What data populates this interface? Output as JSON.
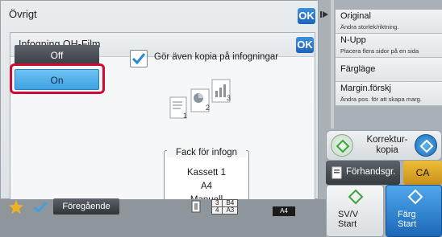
{
  "outer_window": {
    "title": "Övrigt",
    "ok_label": "OK"
  },
  "dialog": {
    "title": "Infogning OH-Film",
    "ok_label": "OK",
    "off_label": "Off",
    "on_label": "On",
    "checkbox_label": "Gör även kopia på infogningar",
    "checkbox_checked": true,
    "page_numbers": [
      "1",
      "2",
      "3"
    ],
    "fack": {
      "title": "Fack för infogn",
      "tray": "Kassett 1",
      "size": "A4",
      "type": "Manuell"
    }
  },
  "right_panel": {
    "items": [
      {
        "title": "Original",
        "subtitle": "Ändra storlek/riktning."
      },
      {
        "title": "N-Upp",
        "subtitle": "Placera flera sidor på en sida"
      },
      {
        "title": "Färgläge",
        "subtitle": ""
      },
      {
        "title": "Margin.förskj",
        "subtitle": "Ändra pos. för att skapa marg."
      }
    ],
    "korrektur_label": "Korrektur-\nkopia",
    "forhandsgr_label": "Förhandsgr.",
    "ca_label": "CA",
    "sv_start_label": "SV/V\nStart",
    "farg_start_label": "Färg\nStart"
  },
  "bottom_bar": {
    "previous_label": "Föregående",
    "tray_rows": [
      {
        "num": "3",
        "size": "B4"
      },
      {
        "num": "4",
        "size": "A3"
      }
    ],
    "current_size": "A4"
  },
  "colors": {
    "accent_blue": "#1d63b8",
    "selected_blue": "#4aa9e6",
    "highlight_red": "#d10a35",
    "ca_yellow": "#e0a52a"
  }
}
